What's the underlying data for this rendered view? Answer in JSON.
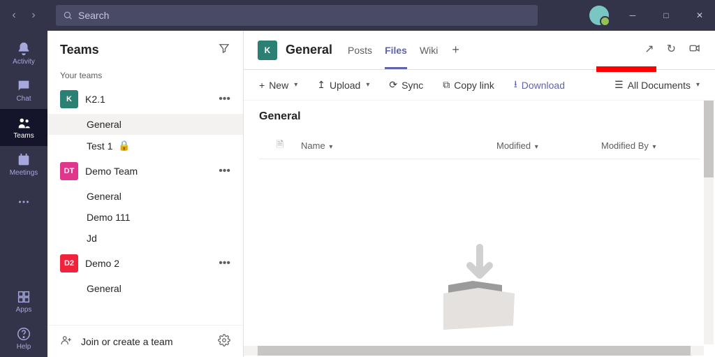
{
  "titlebar": {
    "search_placeholder": "Search"
  },
  "apprail": [
    {
      "id": "activity",
      "label": "Activity",
      "active": false
    },
    {
      "id": "chat",
      "label": "Chat",
      "active": false
    },
    {
      "id": "teams",
      "label": "Teams",
      "active": true
    },
    {
      "id": "meetings",
      "label": "Meetings",
      "active": false
    },
    {
      "id": "more",
      "label": "",
      "active": false
    }
  ],
  "apprail_bottom": [
    {
      "id": "apps",
      "label": "Apps"
    },
    {
      "id": "help",
      "label": "Help"
    }
  ],
  "panel": {
    "title": "Teams",
    "section_label": "Your teams",
    "join_label": "Join or create a team"
  },
  "teams": [
    {
      "abbr": "K",
      "name": "K2.1",
      "color": "#2A8073",
      "channels": [
        {
          "name": "General",
          "active": true
        },
        {
          "name": "Test 1",
          "private": true
        }
      ]
    },
    {
      "abbr": "DT",
      "name": "Demo Team",
      "color": "#E0378D",
      "channels": [
        {
          "name": "General"
        },
        {
          "name": "Demo 111"
        },
        {
          "name": "Jd"
        }
      ]
    },
    {
      "abbr": "D2",
      "name": "Demo 2",
      "color": "#EF233C",
      "channels": [
        {
          "name": "General"
        }
      ]
    }
  ],
  "header": {
    "tile_abbr": "K",
    "title": "General",
    "tabs": [
      {
        "id": "posts",
        "label": "Posts",
        "active": false
      },
      {
        "id": "files",
        "label": "Files",
        "active": true
      },
      {
        "id": "wiki",
        "label": "Wiki",
        "active": false
      }
    ]
  },
  "commands": {
    "new": "New",
    "upload": "Upload",
    "sync": "Sync",
    "copylink": "Copy link",
    "download": "Download",
    "alldocs": "All Documents"
  },
  "files": {
    "folder": "General",
    "columns": {
      "name": "Name",
      "modified": "Modified",
      "modified_by": "Modified By"
    }
  }
}
